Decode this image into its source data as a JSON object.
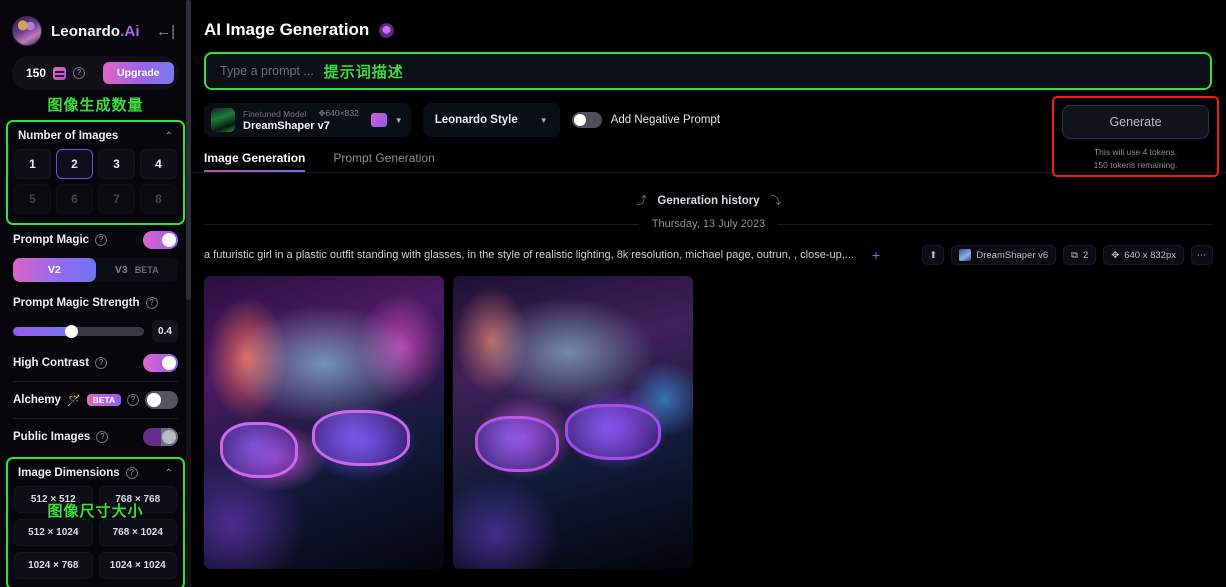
{
  "sidebar": {
    "brand": {
      "name": "Leonardo",
      "suffix": ".Ai",
      "collapse_icon": "←|"
    },
    "tokens": {
      "count": "150",
      "upgrade_label": "Upgrade",
      "help_icon": "?"
    },
    "annotation_images_cn": "图像生成数量",
    "number_of_images": {
      "title": "Number of Images",
      "chevron": "⌃",
      "enabled": [
        "1",
        "2",
        "3",
        "4"
      ],
      "disabled": [
        "5",
        "6",
        "7",
        "8"
      ],
      "selected": "2"
    },
    "prompt_magic": {
      "label": "Prompt Magic",
      "help_icon": "?",
      "enabled": true
    },
    "prompt_magic_version": {
      "v2": "V2",
      "v3": "V3",
      "beta": "BETA",
      "selected": "V2"
    },
    "prompt_magic_strength": {
      "label": "Prompt Magic Strength",
      "help_icon": "?",
      "value": "0.4"
    },
    "high_contrast": {
      "label": "High Contrast",
      "help_icon": "?",
      "enabled": true
    },
    "alchemy": {
      "label": "Alchemy",
      "wand_icon": "🪄",
      "badge": "BETA",
      "help_icon": "?",
      "enabled": false
    },
    "public_images": {
      "label": "Public Images",
      "help_icon": "?",
      "enabled": false
    },
    "annotation_dimensions_cn": "图像尺寸大小",
    "image_dimensions": {
      "title": "Image Dimensions",
      "help_icon": "?",
      "chevron": "⌃",
      "presets": [
        "512 × 512",
        "768 × 768",
        "512 × 1024",
        "768 × 1024",
        "1024 × 768",
        "1024 × 1024"
      ]
    }
  },
  "main": {
    "page_title": "AI Image Generation",
    "prompt_input": {
      "placeholder": "Type a prompt ...",
      "annotation_cn": "提示词描述"
    },
    "model_card": {
      "label": "Finetuned Model",
      "dimensions": "640×832",
      "move_icon": "✥",
      "name": "DreamShaper v7",
      "caret": "▼"
    },
    "style_dropdown": {
      "label": "Leonardo Style",
      "caret": "▼"
    },
    "negative_prompt": {
      "label": "Add Negative Prompt",
      "enabled": false
    },
    "generate": {
      "button_label": "Generate",
      "note_line1": "This will use 4 tokens.",
      "note_line2": "150 tokens remaining."
    },
    "tabs": [
      {
        "label": "Image Generation",
        "active": true
      },
      {
        "label": "Prompt Generation",
        "active": false
      }
    ],
    "history": {
      "title": "Generation history",
      "arrow_left": "⤴",
      "arrow_right": "⤵",
      "date": "Thursday, 13 July 2023",
      "entry": {
        "prompt": "a futuristic girl in a plastic outfit standing with glasses, in the style of realistic lighting, 8k resolution, michael page, outrun, , close-up,...",
        "plus_icon": "+",
        "upload_icon": "⬆",
        "model": "DreamShaper v6",
        "image_count": "2",
        "layers_icon": "⧉",
        "dimensions": "640 x 832px",
        "move_icon": "✥",
        "more_icon": "⋯"
      }
    }
  },
  "colors": {
    "annotation_green": "#35e135",
    "annotation_red": "#f21a1a",
    "accent_purple": "#8f5ef0",
    "accent_pink": "#e264c9",
    "background": "#000000"
  }
}
